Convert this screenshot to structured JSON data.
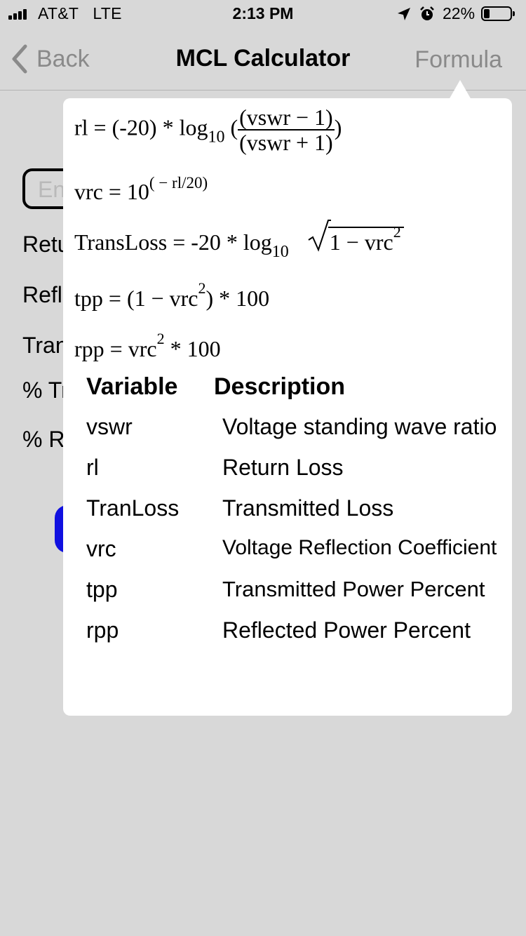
{
  "status_bar": {
    "carrier": "AT&T",
    "network": "LTE",
    "time": "2:13 PM",
    "battery_percent": "22%",
    "battery_level": 0.22,
    "icons": [
      "signal-icon",
      "location-icon",
      "alarm-icon",
      "battery-icon"
    ]
  },
  "nav": {
    "back_label": "Back",
    "title": "MCL Calculator",
    "formula_label": "Formula"
  },
  "background": {
    "input_placeholder": "En",
    "labels": [
      "Retu",
      "Refl",
      "Tran",
      "% Tr",
      "% R"
    ],
    "button_color": "#1010e0"
  },
  "formulas": {
    "f1": {
      "lhs": "rl",
      "eq": "=",
      "coef": "(-20) *",
      "log": "log",
      "base": "10",
      "open": "(",
      "num": "(vswr − 1)",
      "den": "(vswr + 1)",
      "close": ")"
    },
    "f2": {
      "lhs": "vrc",
      "eq": "=",
      "base": "10",
      "exp": "( − rl/20)"
    },
    "f3": {
      "lhs": "TransLoss",
      "eq": "=",
      "coef": "-20 *",
      "log": "log",
      "base": "10",
      "radicand": "1 − vrc",
      "exp": "2"
    },
    "f4": {
      "lhs": "tpp",
      "eq": "=",
      "open": "(1 − vrc",
      "exp": "2",
      "close": ") * 100"
    },
    "f5": {
      "lhs": "rpp",
      "eq": "=",
      "term": "vrc",
      "exp": "2",
      "rest": " * 100"
    }
  },
  "table": {
    "headers": [
      "Variable",
      "Description"
    ],
    "rows": [
      {
        "variable": "vswr",
        "description": "Voltage standing wave ratio"
      },
      {
        "variable": "rl",
        "description": "Return Loss"
      },
      {
        "variable": "TranLoss",
        "description": "Transmitted Loss"
      },
      {
        "variable": "vrc",
        "description": "Voltage Reflection Coefficient"
      },
      {
        "variable": "tpp",
        "description": "Transmitted Power Percent"
      },
      {
        "variable": "rpp",
        "description": "Reflected Power Percent"
      }
    ]
  }
}
